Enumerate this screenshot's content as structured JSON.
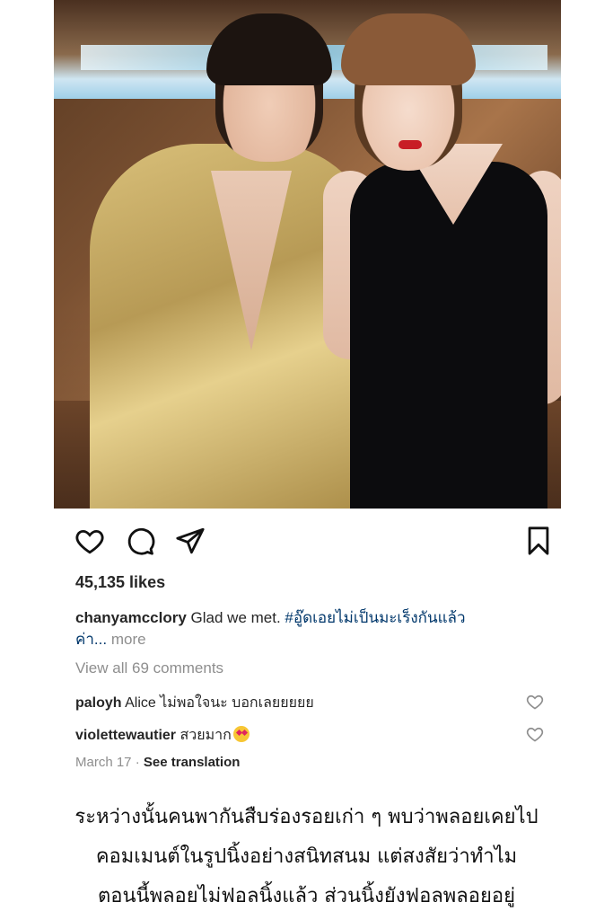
{
  "post": {
    "likes": "45,135 likes",
    "caption": {
      "username": "chanyamcclory",
      "text": "Glad we met.",
      "hashtag": "#อู๊ดเอยไม่เป็นมะเร็งกันแล้ว",
      "continuation": "ค่า...",
      "more": "more"
    },
    "view_comments": "View all 69 comments",
    "comments": [
      {
        "username": "paloyh",
        "text": "Alice ไม่พอใจนะ บอกเลยยยยย"
      },
      {
        "username": "violettewautier",
        "text": "สวยมาก",
        "emoji": "heart-eyes-emoji"
      }
    ],
    "date": "March 17",
    "separator": "·",
    "see_translation": "See translation"
  },
  "icons": {
    "like": "heart-icon",
    "comment": "comment-icon",
    "share": "send-icon",
    "save": "bookmark-icon",
    "comment_like": "heart-icon"
  },
  "article_text": [
    "ระหว่างนั้นคนพากันสืบร่องรอยเก่า ๆ พบว่าพลอยเคยไป",
    "คอมเมนต์ในรูปนิ้งอย่างสนิทสนม แต่สงสัยว่าทำไม",
    "ตอนนี้พลอยไม่ฟอลนิ้งแล้ว ส่วนนิ้งยังฟอลพลอยอยู่"
  ],
  "colors": {
    "text": "#262626",
    "secondary": "#8e8e8e",
    "hashtag": "#00376b"
  }
}
